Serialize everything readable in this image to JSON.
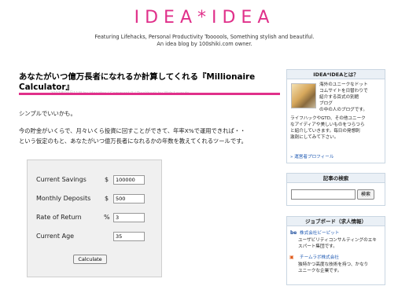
{
  "header": {
    "logo": "IDEA*IDEA",
    "tagline1": "Featuring Lifehacks, Personal Productivity Toooools, Something stylish and beautiful.",
    "tagline2": "An idea blog by 100shiki.com owner."
  },
  "post": {
    "title1": "あなたがいつ億万長者になれるか計算してくれる『Millionaire",
    "title2": "Calculator』",
    "meta": "2007年04月11日 by ideaidea / Comment 0 / Trackback by Web Layouts",
    "p1": "シンプルでいいかも。",
    "p2": "今の貯金がいくらで、月々いくら投資に回すことができて、年率X%で運用できれば・・",
    "p3": "という仮定のもと、あなたがいつ億万長者になれるかの年数を教えてくれるツールです。"
  },
  "calculator": {
    "current_savings_label": "Current Savings",
    "current_savings_symbol": "$",
    "current_savings_value": "100000",
    "monthly_deposits_label": "Monthly Deposits",
    "monthly_deposits_symbol": "$",
    "monthly_deposits_value": "500",
    "rate_of_return_label": "Rate of Return",
    "rate_of_return_symbol": "%",
    "rate_of_return_value": "3",
    "current_age_label": "Current Age",
    "current_age_value": "35",
    "calculate_label": "Calculate"
  },
  "sidebar": {
    "about": {
      "heading": "IDEA*IDEAとは？",
      "l1": "海外のユニークなドット",
      "l2": "コムサイトを日替わりで",
      "l3": "紹介する百式の別館",
      "l4": "ブログ",
      "l5": "の中の人のブログです。",
      "l6": "ライフハックやGTD、その他ユニーク",
      "l7": "なアイディアや美しいものをつらつら",
      "l8": "と紹介していきます。毎日の発想刺",
      "l9": "激剤にしてみて下さい。",
      "link": "» 運営者プロフィール"
    },
    "search": {
      "heading": "記事の検索",
      "button": "検索"
    },
    "jobs": {
      "heading": "ジョブボード（求人情報）",
      "job1_name": "株式会社ビーピット",
      "job1_desc1": "ユーザビリティコンサルティングのエキ",
      "job1_desc2": "スパート集団です。",
      "job2_name": "チームラボ株式会社",
      "job2_desc1": "独特かつ高度な技術を持つ、かなり",
      "job2_desc2": "ユニークな企業です。"
    }
  },
  "colors": {
    "accent": "#e0308a",
    "link": "#1b57b2"
  }
}
